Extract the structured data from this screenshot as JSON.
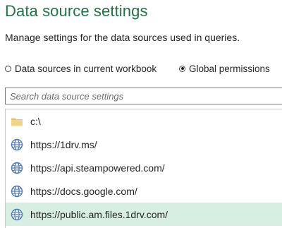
{
  "title": "Data source settings",
  "subtitle": "Manage settings for the data sources used in queries.",
  "scope": {
    "options": [
      {
        "label": "Data sources in current workbook",
        "selected": false
      },
      {
        "label": "Global permissions",
        "selected": true
      }
    ]
  },
  "search": {
    "placeholder": "Search data source settings",
    "value": ""
  },
  "sources": [
    {
      "label": "c:\\",
      "icon": "folder-icon",
      "selected": false
    },
    {
      "label": "https://1drv.ms/",
      "icon": "globe-icon",
      "selected": false
    },
    {
      "label": "https://api.steampowered.com/",
      "icon": "globe-icon",
      "selected": false
    },
    {
      "label": "https://docs.google.com/",
      "icon": "globe-icon",
      "selected": false
    },
    {
      "label": "https://public.am.files.1drv.com/",
      "icon": "globe-icon",
      "selected": true
    }
  ],
  "colors": {
    "title": "#217346",
    "selected_row": "#d6efe0",
    "folder": "#e8c36a",
    "globe": "#4a78b8"
  }
}
